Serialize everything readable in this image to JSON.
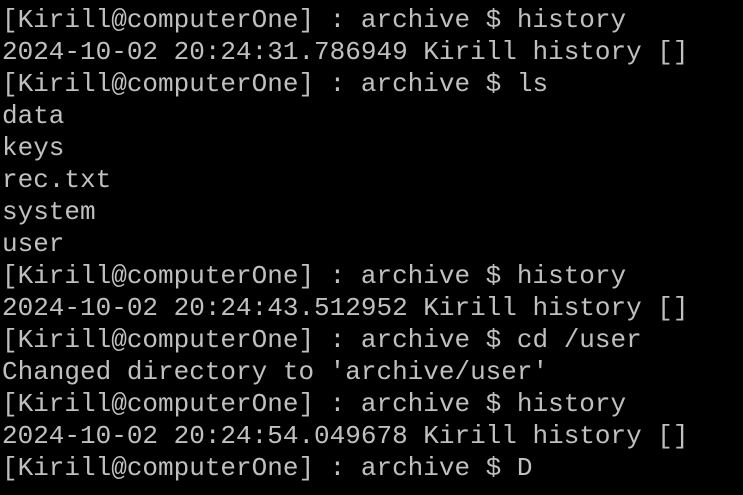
{
  "terminal": {
    "lines": [
      "[Kirill@computerOne] : archive $ history",
      "2024-10-02 20:24:31.786949 Kirill history []",
      "[Kirill@computerOne] : archive $ ls",
      "data",
      "keys",
      "rec.txt",
      "system",
      "user",
      "[Kirill@computerOne] : archive $ history",
      "2024-10-02 20:24:43.512952 Kirill history []",
      "[Kirill@computerOne] : archive $ cd /user",
      "Changed directory to 'archive/user'",
      "[Kirill@computerOne] : archive $ history",
      "2024-10-02 20:24:54.049678 Kirill history []",
      "[Kirill@computerOne] : archive $ D"
    ]
  },
  "colors": {
    "background": "#000000",
    "text": "#c0c0c0"
  }
}
